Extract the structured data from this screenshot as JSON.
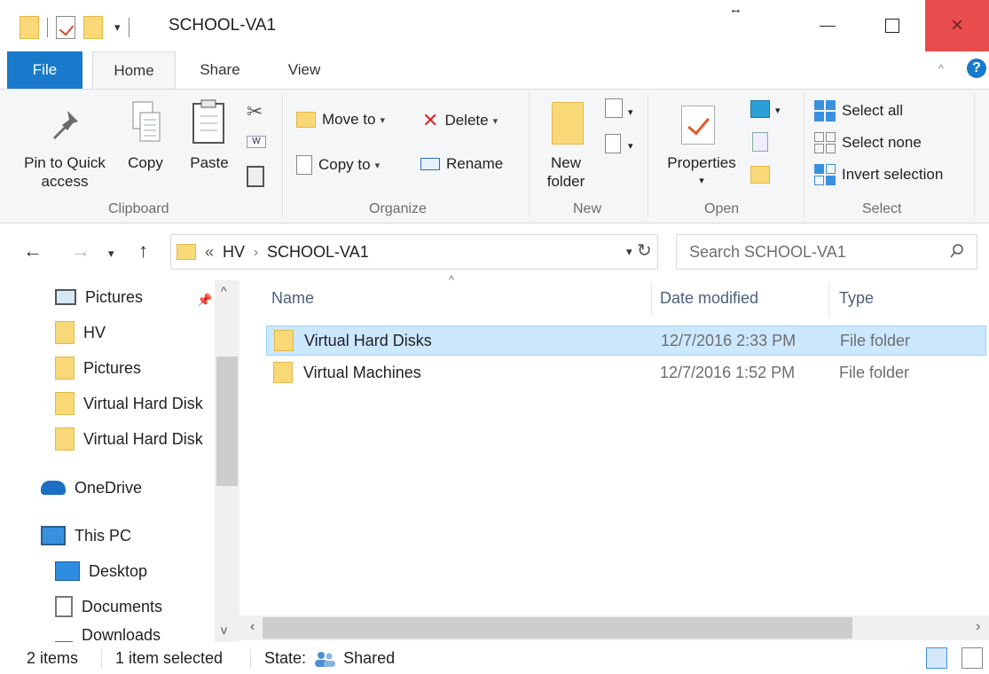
{
  "window": {
    "title": "SCHOOL-VA1",
    "drag_hint": "↔",
    "controls": {
      "minimize": "minimize",
      "maximize": "maximize",
      "close": "×"
    }
  },
  "qat": {
    "dropdown": "▾"
  },
  "ribbon": {
    "tabs": [
      "File",
      "Home",
      "Share",
      "View"
    ],
    "collapse": "^",
    "help": "?",
    "clipboard": {
      "label": "Clipboard",
      "pin_line1": "Pin to Quick",
      "pin_line2": "access",
      "copy": "Copy",
      "paste": "Paste"
    },
    "organize": {
      "label": "Organize",
      "move_to": "Move to",
      "copy_to": "Copy to",
      "delete": "Delete",
      "rename": "Rename"
    },
    "new": {
      "label": "New",
      "new_folder_line1": "New",
      "new_folder_line2": "folder"
    },
    "open": {
      "label": "Open",
      "properties": "Properties"
    },
    "select": {
      "label": "Select",
      "select_all": "Select all",
      "select_none": "Select none",
      "invert": "Invert selection"
    }
  },
  "address": {
    "overflow": "«",
    "crumbs": [
      "HV",
      "SCHOOL-VA1"
    ],
    "search_placeholder": "Search SCHOOL-VA1"
  },
  "nav": {
    "items": [
      {
        "label": "Pictures",
        "icon": "pictures-icon"
      },
      {
        "label": "HV",
        "icon": "folder-icon"
      },
      {
        "label": "Pictures",
        "icon": "folder-icon"
      },
      {
        "label": "Virtual Hard Disk",
        "icon": "folder-icon"
      },
      {
        "label": "Virtual Hard Disk",
        "icon": "folder-icon"
      },
      {
        "label": "OneDrive",
        "icon": "onedrive-icon"
      },
      {
        "label": "This PC",
        "icon": "pc-icon"
      },
      {
        "label": "Desktop",
        "icon": "desktop-icon"
      },
      {
        "label": "Documents",
        "icon": "documents-icon"
      },
      {
        "label": "Downloads",
        "icon": "downloads-icon"
      }
    ]
  },
  "columns": [
    "Name",
    "Date modified",
    "Type"
  ],
  "files": [
    {
      "name": "Virtual Hard Disks",
      "date": "12/7/2016 2:33 PM",
      "type": "File folder",
      "selected": true
    },
    {
      "name": "Virtual Machines",
      "date": "12/7/2016 1:52 PM",
      "type": "File folder",
      "selected": false
    }
  ],
  "status": {
    "items": "2 items",
    "selected": "1 item selected",
    "state_label": "State:",
    "state_value": "Shared"
  },
  "colors": {
    "accent": "#1979ca",
    "selection": "#cce8ff",
    "close_hover": "#e84c4c",
    "folder": "#f8d877"
  }
}
